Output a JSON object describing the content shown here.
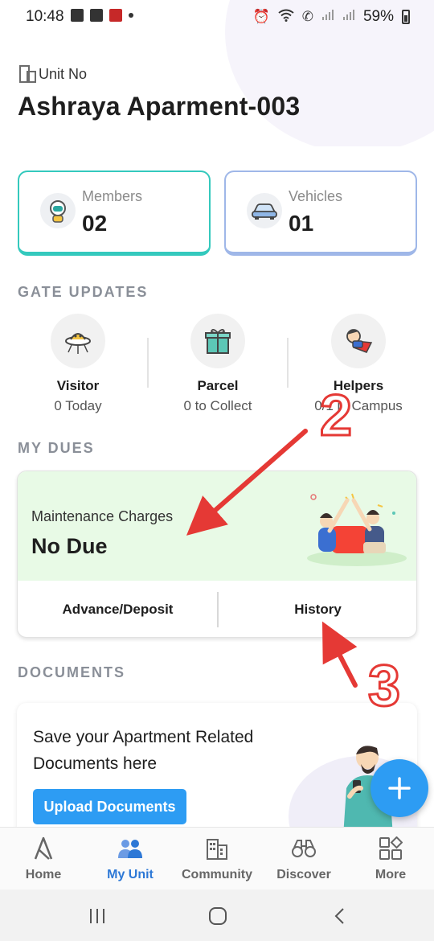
{
  "status_bar": {
    "time": "10:48",
    "battery": "59%"
  },
  "header": {
    "unit_label": "Unit No",
    "unit_title": "Ashraya Aparment-003"
  },
  "stats": {
    "members": {
      "label": "Members",
      "value": "02",
      "icon": "astronaut-icon"
    },
    "vehicles": {
      "label": "Vehicles",
      "value": "01",
      "icon": "car-icon"
    }
  },
  "gate_updates": {
    "title": "GATE UPDATES",
    "items": [
      {
        "name": "Visitor",
        "sub": "0 Today",
        "icon": "ufo-icon"
      },
      {
        "name": "Parcel",
        "sub": "0 to Collect",
        "icon": "gift-icon"
      },
      {
        "name": "Helpers",
        "sub": "0/1 in Campus",
        "icon": "superhero-icon"
      }
    ]
  },
  "my_dues": {
    "title": "MY DUES",
    "label": "Maintenance Charges",
    "status": "No Due",
    "advance_label": "Advance/Deposit",
    "history_label": "History"
  },
  "documents": {
    "title": "DOCUMENTS",
    "text": "Save your Apartment Related Documents here",
    "upload_label": "Upload Documents"
  },
  "bottom_nav": {
    "items": [
      {
        "label": "Home",
        "icon": "home-a-icon"
      },
      {
        "label": "My Unit",
        "icon": "people-icon"
      },
      {
        "label": "Community",
        "icon": "buildings-icon"
      },
      {
        "label": "Discover",
        "icon": "binoculars-icon"
      },
      {
        "label": "More",
        "icon": "grid-icon"
      }
    ],
    "active": "My Unit"
  },
  "annotations": {
    "label_2": "2",
    "label_3": "3"
  },
  "colors": {
    "accent": "#2d9cf3",
    "members_border": "#34c9bd",
    "vehicles_border": "#9fb7e8",
    "dues_bg": "#e8fae6",
    "annotation": "#e53935"
  }
}
